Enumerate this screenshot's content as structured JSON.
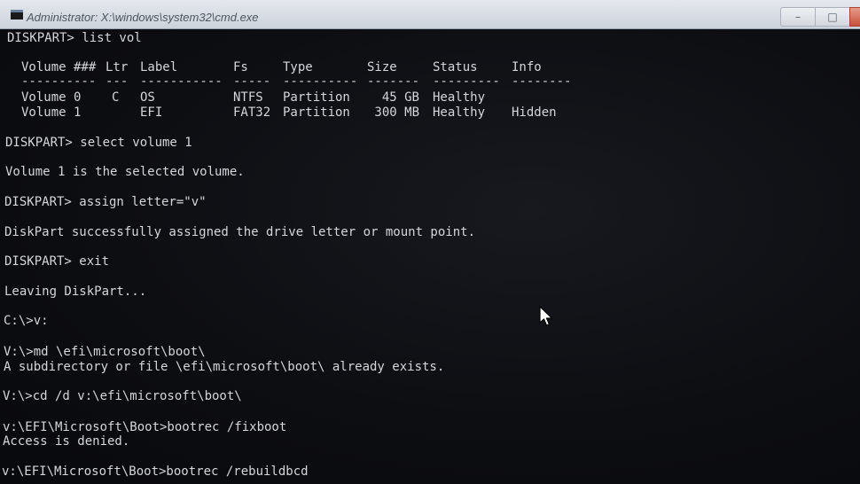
{
  "window": {
    "title": "Administrator: X:\\windows\\system32\\cmd.exe",
    "min_glyph": "–",
    "max_glyph": "□",
    "close_glyph": "✕",
    "icon": "cmd-icon"
  },
  "console": {
    "cmd_list_vol": "DISKPART> list vol",
    "volume_table": {
      "headers": [
        "Volume ###",
        "Ltr",
        "Label",
        "Fs",
        "Type",
        "Size",
        "Status",
        "Info"
      ],
      "separators": [
        "----------",
        "---",
        "-----------",
        "-----",
        "----------",
        "-------",
        "---------",
        "--------"
      ],
      "rows": [
        [
          "Volume 0",
          "C",
          "OS",
          "NTFS",
          "Partition",
          "45 GB",
          "Healthy",
          ""
        ],
        [
          "Volume 1",
          "",
          "EFI",
          "FAT32",
          "Partition",
          "300 MB",
          "Healthy",
          "Hidden"
        ]
      ]
    },
    "cmd_select": "DISKPART> select volume 1",
    "out_select": "Volume 1 is the selected volume.",
    "cmd_assign": "DISKPART> assign letter=\"v\"",
    "out_assign": "DiskPart successfully assigned the drive letter or mount point.",
    "cmd_exit": "DISKPART> exit",
    "out_exit": "Leaving DiskPart...",
    "cmd_switch": "C:\\>v:",
    "cmd_md": "V:\\>md \\efi\\microsoft\\boot\\",
    "out_md": "A subdirectory or file \\efi\\microsoft\\boot\\ already exists.",
    "cmd_cd": "V:\\>cd /d v:\\efi\\microsoft\\boot\\",
    "cmd_fixboot": "v:\\EFI\\Microsoft\\Boot>bootrec /fixboot",
    "out_fixboot": "Access is denied.",
    "cmd_rebuild": "v:\\EFI\\Microsoft\\Boot>bootrec /rebuildbcd"
  },
  "colors": {
    "console_text": "#d4d6dc",
    "console_bg": "#0b0c10",
    "titlebar": "#d8dde4",
    "close_button": "#c6503b"
  }
}
